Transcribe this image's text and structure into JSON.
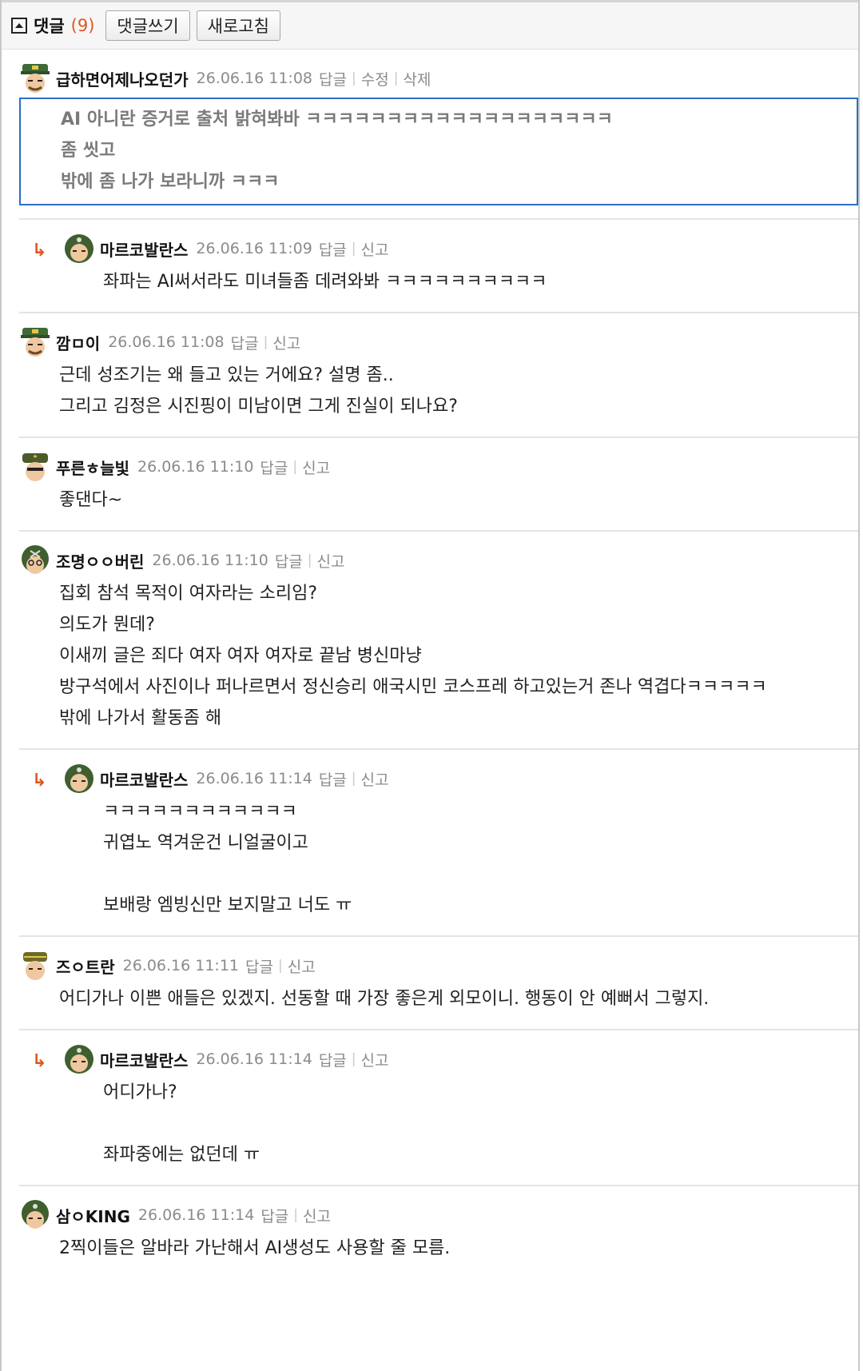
{
  "header": {
    "title": "댓글",
    "count": "(9)",
    "write_label": "댓글쓰기",
    "refresh_label": "새로고침"
  },
  "comments": [
    {
      "author": "급하면어제나오던가",
      "date": "26.06.16 11:08",
      "actions": [
        "답글",
        "수정",
        "삭제"
      ],
      "lines": [
        "AI 아니란 증거로 출처 밝혀봐바 ㅋㅋㅋㅋㅋㅋㅋㅋㅋㅋㅋㅋㅋㅋㅋㅋㅋㅋㅋ",
        "좀 씻고",
        "밖에 좀 나가 보라니까 ㅋㅋㅋ"
      ]
    },
    {
      "author": "마르코발란스",
      "date": "26.06.16 11:09",
      "actions": [
        "답글",
        "신고"
      ],
      "lines": [
        "좌파는 AI써서라도 미녀들좀 데려와봐 ㅋㅋㅋㅋㅋㅋㅋㅋㅋㅋ"
      ]
    },
    {
      "author": "깜ㅁ이",
      "date": "26.06.16 11:08",
      "actions": [
        "답글",
        "신고"
      ],
      "lines": [
        "근데 성조기는 왜 들고 있는 거에요? 설명 좀..",
        "그리고 김정은 시진핑이 미남이면 그게 진실이 되나요?"
      ]
    },
    {
      "author": "푸른ㅎ늘빛",
      "date": "26.06.16 11:10",
      "actions": [
        "답글",
        "신고"
      ],
      "lines": [
        "좋댄다~"
      ]
    },
    {
      "author": "조명ㅇㅇ버린",
      "date": "26.06.16 11:10",
      "actions": [
        "답글",
        "신고"
      ],
      "lines": [
        "집회 참석 목적이 여자라는 소리임?",
        "의도가 뭔데?",
        "이새끼 글은 죄다 여자 여자 여자로 끝남 병신마냥",
        "방구석에서 사진이나 퍼나르면서 정신승리 애국시민 코스프레 하고있는거 존나 역겹다ㅋㅋㅋㅋㅋ",
        "밖에 나가서 활동좀 해"
      ]
    },
    {
      "author": "마르코발란스",
      "date": "26.06.16 11:14",
      "actions": [
        "답글",
        "신고"
      ],
      "lines": [
        "ㅋㅋㅋㅋㅋㅋㅋㅋㅋㅋㅋㅋ",
        "귀엽노 역겨운건 니얼굴이고",
        "",
        "보배랑 엠빙신만 보지말고 너도 ㅠ"
      ]
    },
    {
      "author": "즈ㅇ트란",
      "date": "26.06.16 11:11",
      "actions": [
        "답글",
        "신고"
      ],
      "lines": [
        "어디가나 이쁜 애들은 있겠지. 선동할 때 가장 좋은게 외모이니. 행동이 안 예뻐서 그렇지."
      ]
    },
    {
      "author": "마르코발란스",
      "date": "26.06.16 11:14",
      "actions": [
        "답글",
        "신고"
      ],
      "lines": [
        "어디가나?",
        "",
        "좌파중에는 없던데 ㅠ"
      ]
    },
    {
      "author": "삼ㅇKING",
      "date": "26.06.16 11:14",
      "actions": [
        "답글",
        "신고"
      ],
      "lines": [
        "2찍이들은 알바라 가난해서 AI생성도 사용할 줄 모름."
      ]
    }
  ],
  "icons": {
    "reply": "reply-arrow-icon",
    "toggle": "collapse-toggle-icon",
    "avatar": "soldier-avatar-icon"
  },
  "colors": {
    "accent": "#e2561f",
    "edit_border": "#2d6fc2",
    "meta": "#8b8b8b"
  }
}
